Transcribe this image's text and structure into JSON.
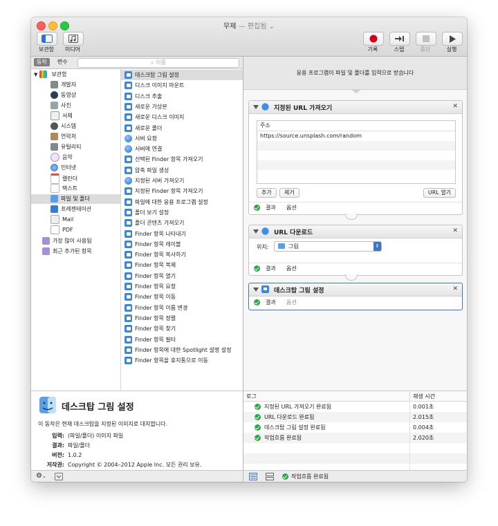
{
  "window": {
    "title": "무제",
    "subtitle": "— 편집됨 ⌄"
  },
  "toolbar": {
    "library_label": "보관함",
    "media_label": "미디어",
    "record_label": "기록",
    "step_label": "스텝",
    "stop_label": "중단",
    "run_label": "실행"
  },
  "tabs": {
    "actions": "동작",
    "variables": "변수"
  },
  "search": {
    "placeholder": "이름"
  },
  "library": {
    "root": "보관함",
    "items": [
      "개발자",
      "동영상",
      "사진",
      "서체",
      "시스템",
      "연락처",
      "유틸리티",
      "음악",
      "인터넷",
      "캘린더",
      "텍스트",
      "파일 및 폴더",
      "프레젠테이션",
      "Mail",
      "PDF"
    ],
    "most_used": "가장 많이 사용됨",
    "recently_added": "최근 추가된 항목"
  },
  "actions": [
    "데스크탑 그림 설정",
    "디스크 이미지 마운트",
    "디스크 추출",
    "새로운 가상본",
    "새로운 디스크 이미지",
    "새로운 폴더",
    "서버 요청",
    "서버에 연결",
    "선택된 Finder 항목 가져오기",
    "압축 파일 생성",
    "지정된 서버 가져오기",
    "지정된 Finder 항목 가져오기",
    "파일에 대한 응용 프로그램 설정",
    "폴더 보기 설정",
    "폴더 콘텐츠 가져오기",
    "Finder 항목 나타내기",
    "Finder 항목 레이블",
    "Finder 항목 복사하기",
    "Finder 항목 복제",
    "Finder 항목 열기",
    "Finder 항목 요청",
    "Finder 항목 이동",
    "Finder 항목 이름 변경",
    "Finder 항목 정렬",
    "Finder 항목 찾기",
    "Finder 항목 필터",
    "Finder 항목에 대한 Spotlight 설명 설정",
    "Finder 항목을 휴지통으로 이동"
  ],
  "description": {
    "title": "데스크탑 그림 설정",
    "text": "이 동작은 현재 데스크탑을 지정된 이미지로 대치합니다.",
    "input_label": "입력:",
    "input_value": "(파일/폴더) 이미지 파일",
    "result_label": "결과:",
    "result_value": "파일/폴더",
    "version_label": "버전:",
    "version_value": "1.0.2",
    "copyright_label": "저작권:",
    "copyright_value": "Copyright © 2004–2012 Apple Inc. 모든 권리 보유."
  },
  "workflow": {
    "hint": "응용 프로그램이 파일 및 폴더를 입력으로 받습니다",
    "card1": {
      "title": "지정된 URL 가져오기",
      "address_header": "주소",
      "url": "https://source.unsplash.com/random",
      "add_button": "추가",
      "remove_button": "제거",
      "open_button": "URL 열기",
      "result": "결과",
      "options": "옵션"
    },
    "card2": {
      "title": "URL 다운로드",
      "location_label": "위치:",
      "location_value": "그림",
      "result": "결과",
      "options": "옵션"
    },
    "card3": {
      "title": "데스크탑 그림 설정",
      "result": "결과",
      "options": "옵션"
    }
  },
  "log": {
    "col_log": "로그",
    "col_duration": "재생 시간",
    "rows": [
      {
        "text": "지정된 URL 가져오기 완료됨",
        "time": "0.001초"
      },
      {
        "text": "URL 다운로드 완료됨",
        "time": "2.015초"
      },
      {
        "text": "데스크탑 그림 설정 완료됨",
        "time": "0.004초"
      },
      {
        "text": "작업흐름 완료됨",
        "time": "2.020초"
      }
    ]
  },
  "status": {
    "text": "작업흐름 완료됨"
  },
  "colors": {
    "accent": "#3b76c7",
    "success": "#27a844",
    "record": "#d0021b"
  }
}
